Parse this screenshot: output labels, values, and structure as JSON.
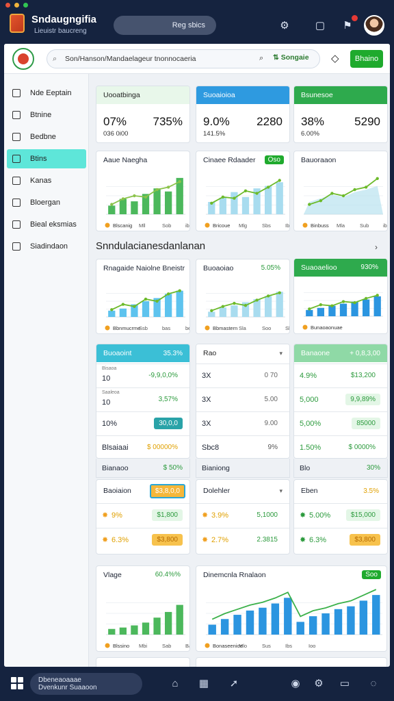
{
  "window": {
    "dots": [
      "#e9533b",
      "#f0b43c",
      "#31c653"
    ],
    "title": "Sndaugngifia",
    "subtitle": "Lieuistr baucreng",
    "search_label": "Reg sbics",
    "icons": [
      "sync-icon",
      "tablet-icon",
      "notification-icon"
    ]
  },
  "header": {
    "search_text": "Son/Hanson/Mandaelageur tnonnocaeria",
    "filter_label": "Songaie",
    "button_label": "Bhaino"
  },
  "sidebar": {
    "items": [
      {
        "label": "Nde Eeptain",
        "icon": "document-icon",
        "active": false
      },
      {
        "label": "Btnine",
        "icon": "book-icon",
        "active": false
      },
      {
        "label": "Bedbne",
        "icon": "folder-icon",
        "active": false
      },
      {
        "label": "Btins",
        "icon": "chat-icon",
        "active": true
      },
      {
        "label": "Kanas",
        "icon": "clipboard-icon",
        "active": false
      },
      {
        "label": "Bloergan",
        "icon": "report-icon",
        "active": false
      },
      {
        "label": "Bieal eksmias",
        "icon": "calendar-icon",
        "active": false
      },
      {
        "label": "Siadindaon",
        "icon": "grid-icon",
        "active": false
      }
    ]
  },
  "stats": [
    {
      "title": "Uooatbinga",
      "head_color": "#e8f7ea",
      "head_text": "#222",
      "left": "07%",
      "right": "735%",
      "sub": "036 0i00"
    },
    {
      "title": "Suoaioioa",
      "head_color": "#2e9ae0",
      "head_text": "#fff",
      "left": "9.0%",
      "right": "2280",
      "sub": "141.5%"
    },
    {
      "title": "Bsunesoe",
      "head_color": "#2eaa4d",
      "head_text": "#fff",
      "left": "38%",
      "right": "5290",
      "sub": "6.00%"
    }
  ],
  "top_charts": [
    {
      "title": "Aaue Naegha",
      "badge": "",
      "legend": "Blscanig",
      "ticks": [
        "Mll",
        "Sob",
        "ibo"
      ],
      "bars": [
        14,
        25,
        21,
        33,
        42,
        37,
        59
      ],
      "line": [
        16,
        25,
        30,
        28,
        40,
        44,
        53
      ],
      "bar_color": "#4cb85c"
    },
    {
      "title": "Cinaee Rdaader",
      "badge": "Oso",
      "legend": "Bricoue",
      "ticks": [
        "Mlg",
        "Sbs",
        "Ibs"
      ],
      "bars": [
        20,
        27,
        36,
        28,
        42,
        46,
        52
      ],
      "line": [
        18,
        28,
        26,
        38,
        34,
        44,
        55
      ],
      "bar_color": "#a8dcef"
    },
    {
      "title": "Bauoraaon",
      "badge": "",
      "legend": "Binbuss",
      "ticks": [
        "Mla",
        "Sub",
        "ibo"
      ],
      "area": [
        20,
        26,
        32,
        28,
        36,
        40,
        46
      ],
      "line": [
        16,
        22,
        34,
        30,
        40,
        44,
        58
      ],
      "bar_color": "#b9e2ef"
    }
  ],
  "section": {
    "title": "Snndulacianesdanlanan"
  },
  "mid_charts": [
    {
      "title": "Rnagaide Naiolne Bneistr",
      "badge": "",
      "legend": "Bbnmucrme",
      "ticks": [
        "Ssb",
        "bas",
        "bes"
      ],
      "bars": [
        12,
        16,
        24,
        30,
        36,
        44,
        50
      ],
      "line": [
        14,
        24,
        20,
        34,
        30,
        44,
        50
      ]
    },
    {
      "title": "Buoaoiao",
      "badge": "5.05%",
      "legend": "Bbmastern",
      "ticks": [
        "Sla",
        "Soo",
        "Sbs"
      ],
      "bars": [
        10,
        18,
        22,
        28,
        34,
        40,
        48
      ],
      "line": [
        12,
        20,
        26,
        22,
        32,
        40,
        46
      ]
    },
    {
      "title": "Suaoaelioo",
      "badge": "930%",
      "legend": "Bunaoaonuae",
      "ticks": [],
      "bars": [
        12,
        16,
        20,
        24,
        28,
        32,
        38
      ],
      "line": [
        14,
        22,
        20,
        28,
        26,
        34,
        40
      ]
    }
  ],
  "tables": [
    {
      "title": "Buoaoint",
      "badge": "35.3%",
      "head_color": "#3bbfd6",
      "head_text": "#fff",
      "rows": [
        {
          "label": "Bisaoa",
          "value": "10",
          "right": "-9,9,0,0%",
          "pill": ""
        },
        {
          "label": "Saaleoa",
          "value": "10",
          "right": "3,57%",
          "pill": ""
        },
        {
          "label": "",
          "value": "10%",
          "right": "30,0,0",
          "pill": "teal"
        },
        {
          "label": "",
          "value": "Blsaiaai",
          "right": "$ 00000%",
          "pill": "orange"
        }
      ],
      "footer": {
        "label": "Bianaoo",
        "right": "$ 50%"
      }
    },
    {
      "title": "Rao",
      "badge": "",
      "head_color": "#ffffff",
      "head_text": "#222",
      "rows": [
        {
          "label": "",
          "value": "3X",
          "right": "0 70",
          "pill": ""
        },
        {
          "label": "",
          "value": "3X",
          "right": "5.00",
          "pill": ""
        },
        {
          "label": "",
          "value": "3X",
          "right": "9.00",
          "pill": ""
        },
        {
          "label": "",
          "value": "Sbc8",
          "right": "9%",
          "pill": "coin"
        }
      ],
      "footer": {
        "label": "Bianiong",
        "right": ""
      }
    },
    {
      "title": "Banaone",
      "badge": "+ 0,8,3,00",
      "head_color": "#8fd9a6",
      "head_text": "#fff",
      "rows": [
        {
          "label": "",
          "value": "4.9%",
          "right": "$13,200",
          "pill": ""
        },
        {
          "label": "",
          "value": "5,000",
          "right": "9,9,89%",
          "pill": "green"
        },
        {
          "label": "",
          "value": "5,00%",
          "right": "85000",
          "pill": "green"
        },
        {
          "label": "",
          "value": "1.50%",
          "right": "$ 0000%",
          "pill": ""
        }
      ],
      "footer": {
        "label": "Blo",
        "right": "30%"
      }
    }
  ],
  "tables2": [
    {
      "title": "Baoiaion",
      "badge": "$3,8,0,0",
      "rows": [
        {
          "value": "9%",
          "right": "$1,800",
          "pill": "green"
        },
        {
          "value": "6.3%",
          "right": "$3,800",
          "pill": "yellow"
        }
      ]
    },
    {
      "title": "Dolehler",
      "badge": "",
      "rows": [
        {
          "value": "3.9%",
          "right": "5,1000",
          "pill": ""
        },
        {
          "value": "2.7%",
          "right": "2.3815",
          "pill": ""
        }
      ]
    },
    {
      "title": "Eben",
      "badge": "3.5%",
      "rows": [
        {
          "value": "5.00%",
          "right": "$15,000",
          "pill": "green"
        },
        {
          "value": "6.3%",
          "right": "$3,800",
          "pill": "yellow"
        }
      ]
    }
  ],
  "bottom_charts": [
    {
      "title": "Vlage",
      "badge": "60.4%%",
      "legend": "Blssino",
      "ticks": [
        "Mbi",
        "Sab",
        "Bas"
      ],
      "bars": [
        8,
        10,
        13,
        17,
        24,
        32,
        42
      ],
      "bar_color": "#4cb85c"
    },
    {
      "title": "Dinemcnla Rnalaon",
      "badge": "Soo",
      "legend": "Bonaseenioe",
      "ticks": [
        "Mlo",
        "Sus",
        "Ibs",
        "Ioo"
      ],
      "bars": [
        14,
        22,
        28,
        34,
        38,
        44,
        52,
        18,
        26,
        30,
        36,
        40,
        48,
        56
      ]
    }
  ],
  "bottombar": {
    "line1": "Dbeneaoaaae",
    "line2": "Dvenkunr Suaaoon",
    "icons": [
      "home-icon",
      "grid-icon",
      "rocket-icon",
      "globe-icon",
      "settings-icon",
      "message-icon",
      "chat-bubble-icon"
    ]
  }
}
